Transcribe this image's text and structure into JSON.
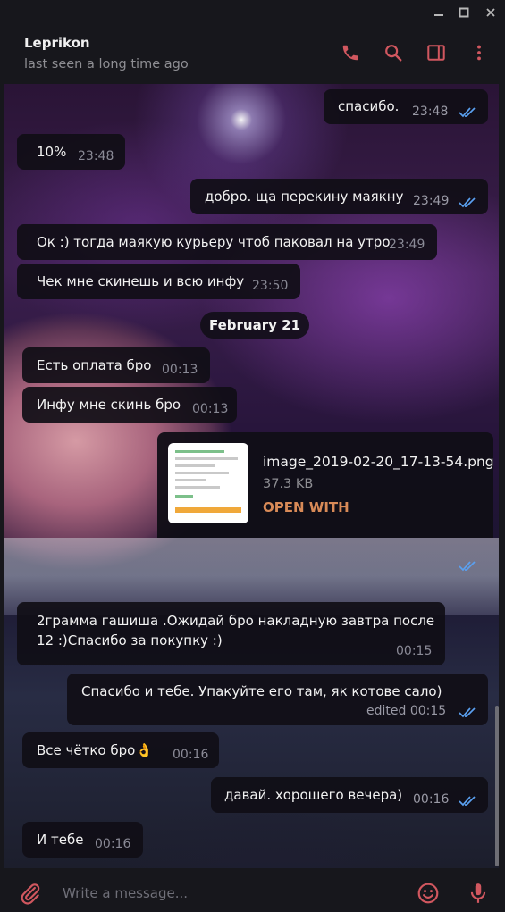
{
  "window": {
    "minimize_glyph": "—",
    "maximize_glyph": "☐",
    "close_glyph": "✕"
  },
  "header": {
    "name": "Leprikon",
    "status": "last seen a long time ago",
    "icons": [
      "phone-icon",
      "search-icon",
      "sidebar-toggle-icon",
      "more-vertical-icon"
    ]
  },
  "colors": {
    "accent": "#d1575f",
    "link": "#d88a57",
    "check": "#5aa0f0"
  },
  "messages": {
    "m1": {
      "text": "спасибо.",
      "time": "23:48"
    },
    "m2": {
      "text": "10%",
      "time": "23:48"
    },
    "m3": {
      "text": "добро. ща перекину маякну",
      "time": "23:49"
    },
    "m4": {
      "text": "Ок :) тогда маякую курьеру чтоб паковал на утро",
      "time": "23:49"
    },
    "m5": {
      "text": "Чек мне скинешь и всю инфу",
      "time": "23:50"
    },
    "date": "February 21",
    "m6": {
      "text": "Есть оплата бро",
      "time": "00:13"
    },
    "m7": {
      "text": "Инфу мне скинь бро",
      "time": "00:13"
    },
    "file": {
      "name": "image_2019-02-20_17-13-54.png",
      "size": "37.3 KB",
      "action": "OPEN WITH"
    },
    "m8": {
      "line1": "2грамма гашиша .Ожидай бро накладную завтра после",
      "line2": "12 :)Спасибо за покупку :)",
      "time": "00:15"
    },
    "m9": {
      "text": "Спасибо и тебе. Упакуйте его там, як котове сало)",
      "time": "edited 00:15"
    },
    "m10": {
      "text": "Все чётко бро",
      "time": "00:16"
    },
    "m11": {
      "text": "давай. хорошего вечера)",
      "time": "00:16"
    },
    "m12": {
      "text": "И тебе",
      "time": "00:16"
    }
  },
  "composer": {
    "placeholder": "Write a message..."
  }
}
